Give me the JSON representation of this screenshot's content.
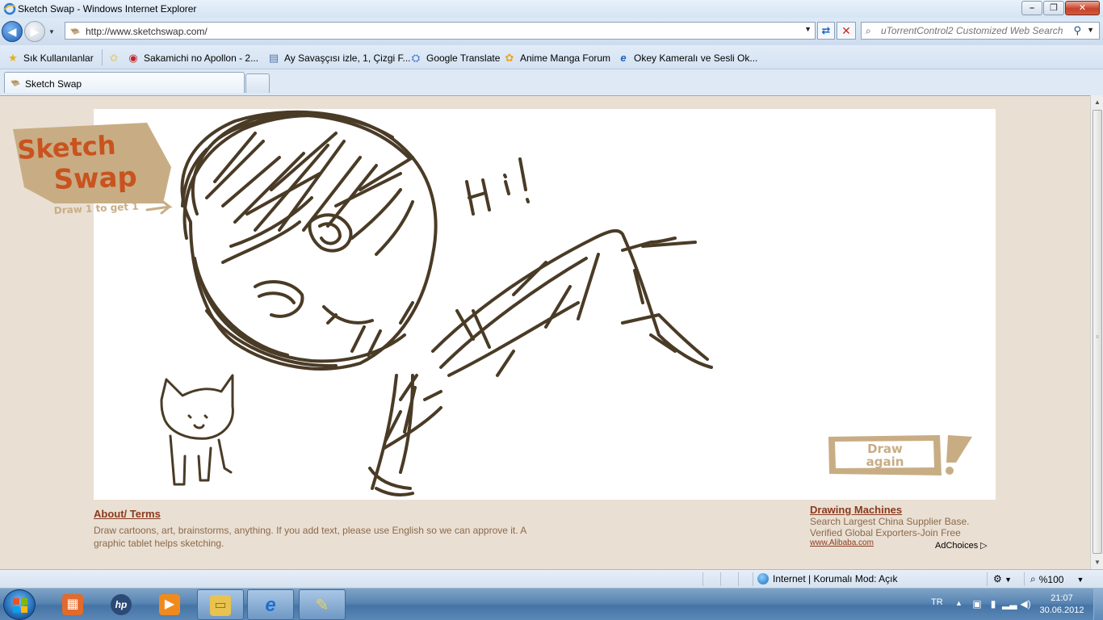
{
  "window": {
    "title": "Sketch Swap - Windows Internet Explorer",
    "minimize": "–",
    "maximize": "❐",
    "close": "✕"
  },
  "nav": {
    "url": "http://www.sketchswap.com/",
    "search_placeholder": "uTorrentControl2 Customized Web Search"
  },
  "favorites": [
    {
      "label": "Sık Kullanılanlar",
      "icon": "star-icon"
    },
    {
      "label": "Sakamichi no Apollon - 2...",
      "icon": "site-icon"
    },
    {
      "label": "Ay Savaşçısı izle, 1, Çizgi F...",
      "icon": "page-icon"
    },
    {
      "label": "Google Translate",
      "icon": "translate-icon"
    },
    {
      "label": "Anime Manga Forum",
      "icon": "forum-icon"
    },
    {
      "label": "Okey  Kameralı ve Sesli Ok...",
      "icon": "ie-icon"
    }
  ],
  "tabs": [
    {
      "label": "Sketch Swap"
    }
  ],
  "page": {
    "logo_line1": "Sketch",
    "logo_line2": "Swap",
    "logo_tagline": "Draw 1 to get 1",
    "drawing_text": "Hi!",
    "draw_again_line1": "Draw",
    "draw_again_line2": "again",
    "about_link": "About/ Terms",
    "description": "Draw cartoons, art, brainstorms, anything. If you add text, please use English so we can approve it. A graphic tablet helps sketching.",
    "ad": {
      "title": "Drawing Machines",
      "text": "Search Largest China Supplier Base. Verified Global Exporters-Join Free",
      "link": "www.Alibaba.com",
      "choices": "AdChoices"
    }
  },
  "status": {
    "zone": "Internet | Korumalı Mod: Açık",
    "zoom": "%100"
  },
  "tray": {
    "language": "TR",
    "time": "21:07",
    "date": "30.06.2012"
  },
  "colors": {
    "sketch_stroke": "#4a3b26",
    "brand_orange": "#c9531f",
    "brand_tan": "#c8ad84",
    "page_bg": "#eadfd3"
  }
}
